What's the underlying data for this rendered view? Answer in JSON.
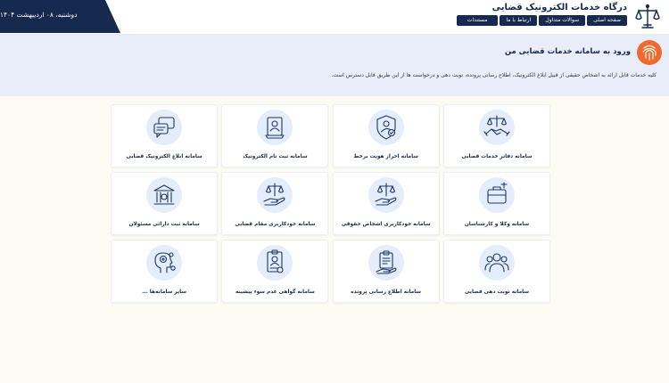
{
  "header": {
    "site_title": "درگاه خدمات الکترونیک قضایی",
    "date": "دوشنبه، ۰۸ اردیبهشت ۱۴۰۴",
    "nav": [
      {
        "label": "صفحه اصلی"
      },
      {
        "label": "سوالات متداول"
      },
      {
        "label": "ارتباط با ما"
      },
      {
        "label": "مستندات"
      }
    ]
  },
  "intro": {
    "title": "ورود به سامانه خدمات قضایی من",
    "description": "کلیه خدمات قابل ارائه به اشخاص حقیقی از قبیل ابلاغ الکترونیک، اطلاع رسانی پرونده، نوبت دهی و درخواست ها از این طریق قابل دسترس است."
  },
  "cards": [
    {
      "label": "سامانه دفاتر خدمات قضایی",
      "icon": "handshake-scales-icon"
    },
    {
      "label": "سامانه احراز هویت برخط",
      "icon": "shield-user-icon"
    },
    {
      "label": "سامانه ثبت نام الکترونیک",
      "icon": "id-card-icon"
    },
    {
      "label": "سامانه ابلاغ الکترونیک قضایی",
      "icon": "chat-bubbles-icon"
    },
    {
      "label": "سامانه وکلا و کارشناسان",
      "icon": "briefcase-scales-icon"
    },
    {
      "label": "سامانه خودکاربری اشخاص حقوقی",
      "icon": "hand-scales-icon"
    },
    {
      "label": "سامانه خودکاربری مقام قضایی",
      "icon": "hand-scales-icon"
    },
    {
      "label": "سامانه ثبت دارائی مسئولان",
      "icon": "building-money-icon"
    },
    {
      "label": "سامانه نوبت دهی قضایی",
      "icon": "people-group-icon"
    },
    {
      "label": "سامانه اطلاع رسانی پرونده",
      "icon": "clipboard-hand-icon"
    },
    {
      "label": "سامانه گواهی عدم سوء پیشینه",
      "icon": "certificate-user-icon"
    },
    {
      "label": "سایر سامانه‌ها ...",
      "icon": "head-gears-icon"
    }
  ],
  "colors": {
    "navy": "#16294f",
    "accent_orange": "#ee6a2e",
    "icon_circle": "#e3edfb",
    "intro_band": "#e9edfa"
  }
}
